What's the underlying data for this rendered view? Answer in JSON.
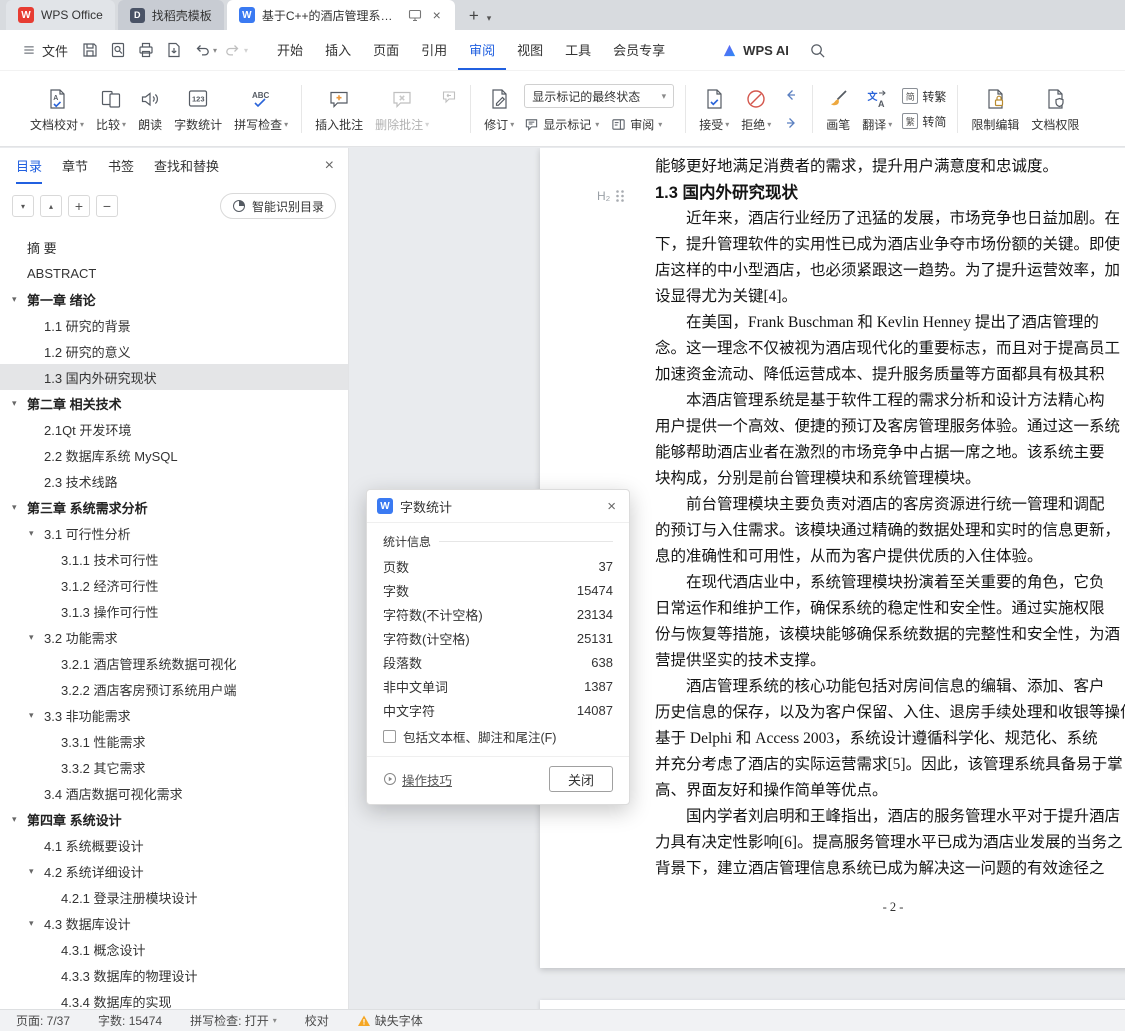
{
  "tabbar": {
    "home": {
      "label": "WPS Office"
    },
    "docer": {
      "label": "找稻壳模板"
    },
    "doc": {
      "label": "基于C++的酒店管理系统 毕业"
    },
    "new_tab": "+"
  },
  "menu": {
    "file": "文件",
    "tabs": [
      {
        "label": "开始"
      },
      {
        "label": "插入"
      },
      {
        "label": "页面"
      },
      {
        "label": "引用"
      },
      {
        "label": "审阅",
        "active": true
      },
      {
        "label": "视图"
      },
      {
        "label": "工具"
      },
      {
        "label": "会员专享"
      }
    ],
    "wps_ai": "WPS AI"
  },
  "ribbon": {
    "proof": "文档校对",
    "compare": "比较",
    "read_aloud": "朗读",
    "word_count": "字数统计",
    "spell_check": "拼写检查",
    "insert_comment": "插入批注",
    "delete_comment": "删除批注",
    "track_changes": "修订",
    "markup_state": "显示标记的最终状态",
    "show_markup": "显示标记",
    "review_pane": "审阅",
    "accept": "接受",
    "reject": "拒绝",
    "pen": "画笔",
    "translate": "翻译",
    "to_traditional": "转繁",
    "to_simplified": "转简",
    "trad_tag": "简",
    "simp_tag": "繁",
    "restrict_edit": "限制编辑",
    "doc_permission": "文档权限"
  },
  "sidebar": {
    "tabs": [
      {
        "label": "目录",
        "active": true
      },
      {
        "label": "章节"
      },
      {
        "label": "书签"
      },
      {
        "label": "查找和替换"
      }
    ],
    "smart_toc": "智能识别目录",
    "outline": [
      {
        "label": "摘  要",
        "level": 0
      },
      {
        "label": "ABSTRACT",
        "level": 0
      },
      {
        "label": "第一章  绪论",
        "level": 0,
        "arrow": true,
        "bold": true
      },
      {
        "label": "1.1 研究的背景",
        "level": 1
      },
      {
        "label": "1.2 研究的意义",
        "level": 1
      },
      {
        "label": "1.3 国内外研究现状",
        "level": 1,
        "selected": true
      },
      {
        "label": "第二章 相关技术",
        "level": 0,
        "arrow": true,
        "bold": true
      },
      {
        "label": "2.1Qt 开发环境",
        "level": 1
      },
      {
        "label": "2.2 数据库系统 MySQL",
        "level": 1
      },
      {
        "label": "2.3 技术线路",
        "level": 1
      },
      {
        "label": "第三章 系统需求分析",
        "level": 0,
        "arrow": true,
        "bold": true
      },
      {
        "label": "3.1 可行性分析",
        "level": 1,
        "arrow": true
      },
      {
        "label": "3.1.1 技术可行性",
        "level": 2
      },
      {
        "label": "3.1.2 经济可行性",
        "level": 2
      },
      {
        "label": "3.1.3 操作可行性",
        "level": 2
      },
      {
        "label": "3.2 功能需求",
        "level": 1,
        "arrow": true
      },
      {
        "label": "3.2.1 酒店管理系统数据可视化",
        "level": 2
      },
      {
        "label": "3.2.2 酒店客房预订系统用户端",
        "level": 2
      },
      {
        "label": "3.3 非功能需求",
        "level": 1,
        "arrow": true
      },
      {
        "label": "3.3.1 性能需求",
        "level": 2
      },
      {
        "label": "3.3.2 其它需求",
        "level": 2
      },
      {
        "label": "3.4 酒店数据可视化需求",
        "level": 1
      },
      {
        "label": "第四章  系统设计",
        "level": 0,
        "arrow": true,
        "bold": true
      },
      {
        "label": "4.1 系统概要设计",
        "level": 1
      },
      {
        "label": "4.2 系统详细设计",
        "level": 1,
        "arrow": true
      },
      {
        "label": "4.2.1 登录注册模块设计",
        "level": 2
      },
      {
        "label": "4.3 数据库设计",
        "level": 1,
        "arrow": true
      },
      {
        "label": "4.3.1 概念设计",
        "level": 2
      },
      {
        "label": "4.3.3 数据库的物理设计",
        "level": 2
      },
      {
        "label": "4.3.4 数据库的实现",
        "level": 2
      }
    ]
  },
  "document": {
    "prev_line": "能够更好地满足消费者的需求，提升用户满意度和忠诚度。",
    "heading_marker": "H₂",
    "heading": "1.3 国内外研究现状",
    "lines": [
      "　　近年来，酒店行业经历了迅猛的发展，市场竞争也日益加剧。在",
      "下，提升管理软件的实用性已成为酒店业争夺市场份额的关键。即使",
      "店这样的中小型酒店，也必须紧跟这一趋势。为了提升运营效率，加",
      "设显得尤为关键[4]。",
      "　　在美国，Frank Buschman 和 Kevlin Henney 提出了酒店管理的",
      "念。这一理念不仅被视为酒店现代化的重要标志，而且对于提高员工",
      "加速资金流动、降低运营成本、提升服务质量等方面都具有极其积",
      "　　本酒店管理系统是基于软件工程的需求分析和设计方法精心构",
      "用户提供一个高效、便捷的预订及客房管理服务体验。通过这一系统",
      "能够帮助酒店业者在激烈的市场竞争中占据一席之地。该系统主要",
      "块构成，分别是前台管理模块和系统管理模块。",
      "　　前台管理模块主要负责对酒店的客房资源进行统一管理和调配",
      "的预订与入住需求。该模块通过精确的数据处理和实时的信息更新，",
      "息的准确性和可用性，从而为客户提供优质的入住体验。",
      "　　在现代酒店业中，系统管理模块扮演着至关重要的角色，它负",
      "日常运作和维护工作，确保系统的稳定性和安全性。通过实施权限",
      "份与恢复等措施，该模块能够确保系统数据的完整性和安全性，为酒",
      "营提供坚实的技术支撑。",
      "　　酒店管理系统的核心功能包括对房间信息的编辑、添加、客户",
      "历史信息的保存，以及为客户保留、入住、退房手续处理和收银等操作",
      "基于 Delphi 和 Access 2003，系统设计遵循科学化、规范化、系统",
      "并充分考虑了酒店的实际运营需求[5]。因此，该管理系统具备易于掌",
      "高、界面友好和操作简单等优点。",
      "　　国内学者刘启明和王峰指出，酒店的服务管理水平对于提升酒店",
      "力具有决定性影响[6]。提高服务管理水平已成为酒店业发展的当务之",
      "背景下，建立酒店管理信息系统已成为解决这一问题的有效途径之"
    ],
    "page_footer": "- 2 -"
  },
  "dialog": {
    "title": "字数统计",
    "section": "统计信息",
    "stats": [
      {
        "label": "页数",
        "value": "37"
      },
      {
        "label": "字数",
        "value": "15474"
      },
      {
        "label": "字符数(不计空格)",
        "value": "23134"
      },
      {
        "label": "字符数(计空格)",
        "value": "25131"
      },
      {
        "label": "段落数",
        "value": "638"
      },
      {
        "label": "非中文单词",
        "value": "1387"
      },
      {
        "label": "中文字符",
        "value": "14087"
      }
    ],
    "checkbox_label": "包括文本框、脚注和尾注(F)",
    "tips_link": "操作技巧",
    "close_button": "关闭"
  },
  "statusbar": {
    "page": "页面: 7/37",
    "word_count": "字数: 15474",
    "spell": "拼写检查: 打开",
    "proofread": "校对",
    "missing_font": "缺失字体"
  }
}
